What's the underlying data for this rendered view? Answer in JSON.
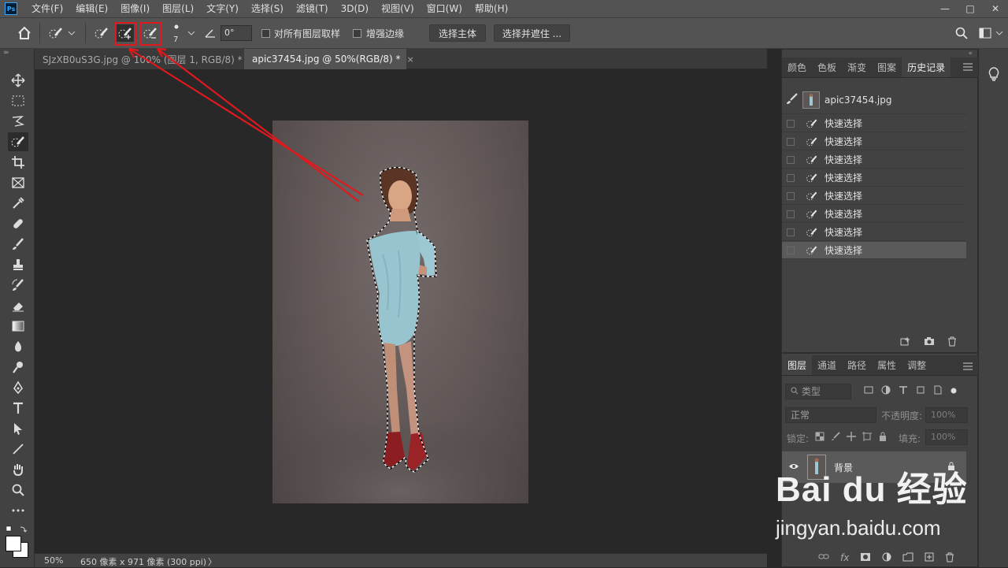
{
  "app": {
    "logo": "Ps"
  },
  "menu": [
    "文件(F)",
    "编辑(E)",
    "图像(I)",
    "图层(L)",
    "文字(Y)",
    "选择(S)",
    "滤镜(T)",
    "3D(D)",
    "视图(V)",
    "窗口(W)",
    "帮助(H)"
  ],
  "window_controls": {
    "minimize": "—",
    "maximize": "□",
    "close": "✕"
  },
  "options_bar": {
    "brush_size": "7",
    "angle": "0°",
    "sample_all_layers": "对所有图层取样",
    "enhance_edge": "增强边缘",
    "select_subject": "选择主体",
    "select_and_mask": "选择并遮住 ..."
  },
  "doc_tabs": [
    {
      "label": "SJzXB0uS3G.jpg @ 100% (图层 1, RGB/8) *",
      "close": "×"
    },
    {
      "label": "apic37454.jpg @ 50%(RGB/8) *",
      "close": "×"
    }
  ],
  "status": {
    "zoom": "50%",
    "doc_info": "650 像素 x 971 像素 (300 ppi)",
    "arrow": "〉"
  },
  "history_panel": {
    "tabs": [
      "颜色",
      "色板",
      "渐变",
      "图案",
      "历史记录"
    ],
    "active_tab": "历史记录",
    "snapshot": "apic37454.jpg",
    "states": [
      "快速选择",
      "快速选择",
      "快速选择",
      "快速选择",
      "快速选择",
      "快速选择",
      "快速选择",
      "快速选择"
    ]
  },
  "layers_panel": {
    "tabs": [
      "图层",
      "通道",
      "路径",
      "属性",
      "调整"
    ],
    "active_tab": "图层",
    "filter_placeholder": "类型",
    "blend_mode": "正常",
    "opacity_label": "不透明度:",
    "opacity_value": "100%",
    "lock_label": "锁定:",
    "fill_label": "填充:",
    "fill_value": "100%",
    "layers": [
      {
        "name": "背景",
        "locked": true,
        "visible": true
      }
    ]
  },
  "watermark": {
    "brand": "Bai du 经验",
    "url": "jingyan.baidu.com"
  },
  "colors": {
    "annotation_red": "#e0191e",
    "selection": "#ffffff"
  }
}
